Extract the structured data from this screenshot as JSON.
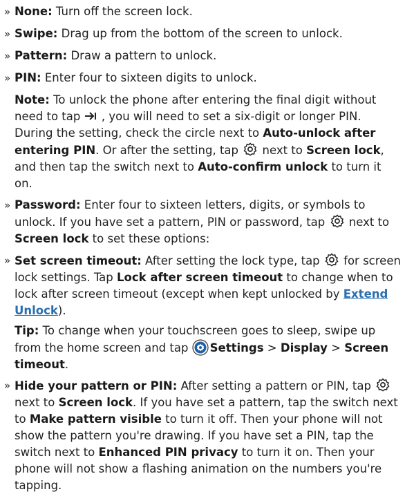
{
  "items": {
    "none": {
      "label": "None:",
      "text": " Turn off the screen lock."
    },
    "swipe": {
      "label": "Swipe:",
      "text": " Drag up from the bottom of the screen to unlock."
    },
    "pattern": {
      "label": "Pattern:",
      "text": " Draw a pattern to unlock."
    },
    "pin": {
      "label": "PIN:",
      "text": " Enter four to sixteen digits to unlock."
    },
    "password": {
      "label": "Password:",
      "text1": " Enter four to sixteen letters, digits, or symbols to unlock. If you have set a pattern, PIN or password, tap ",
      "text2": " next to ",
      "b1": "Screen lock",
      "text3": " to set these options:"
    },
    "timeout": {
      "label": "Set screen timeout:",
      "text1": " After setting the lock type, tap ",
      "text2": " for screen lock settings. Tap ",
      "b1": "Lock after screen timeout",
      "text3": " to change when to lock after screen timeout (except when kept unlocked by ",
      "link": "Extend Unlock",
      "text4": ")."
    },
    "hide": {
      "label": "Hide your pattern or PIN:",
      "text1": " After setting a pattern or PIN, tap ",
      "text2": " next to ",
      "b1": "Screen lock",
      "text3": ". If you have set a pattern, tap the switch next to ",
      "b2": "Make pattern visible",
      "text4": " to turn it off. Then your phone will not show the pattern you're drawing. If you have set a PIN, tap the switch next to ",
      "b3": "Enhanced PIN privacy",
      "text5": " to turn it on. Then your phone will not show a flashing animation on the numbers you're tapping."
    }
  },
  "note": {
    "label": "Note:",
    "text1": " To unlock the phone after entering the final digit without need to tap ",
    "text2": " , you will need to set a six-digit or longer PIN. During the setting, check the circle next to ",
    "b1": "Auto-unlock after entering PIN",
    "text3": ". Or after the setting, tap ",
    "text4": " next to ",
    "b2": "Screen lock",
    "text5": ", and then tap the switch next to ",
    "b3": "Auto-confirm unlock",
    "text6": " to turn it on."
  },
  "tip": {
    "label": "Tip:",
    "text1": " To change when your touchscreen goes to sleep, swipe up from the home screen and tap ",
    "b1": "Settings",
    "sep1": " > ",
    "b2": "Display",
    "sep2": " > ",
    "b3": "Screen timeout",
    "text2": "."
  },
  "bullet": "»",
  "colors": {
    "accent": "#2a6fb0",
    "text": "#222222",
    "settings_icon_bg": "#1f5fa8"
  }
}
